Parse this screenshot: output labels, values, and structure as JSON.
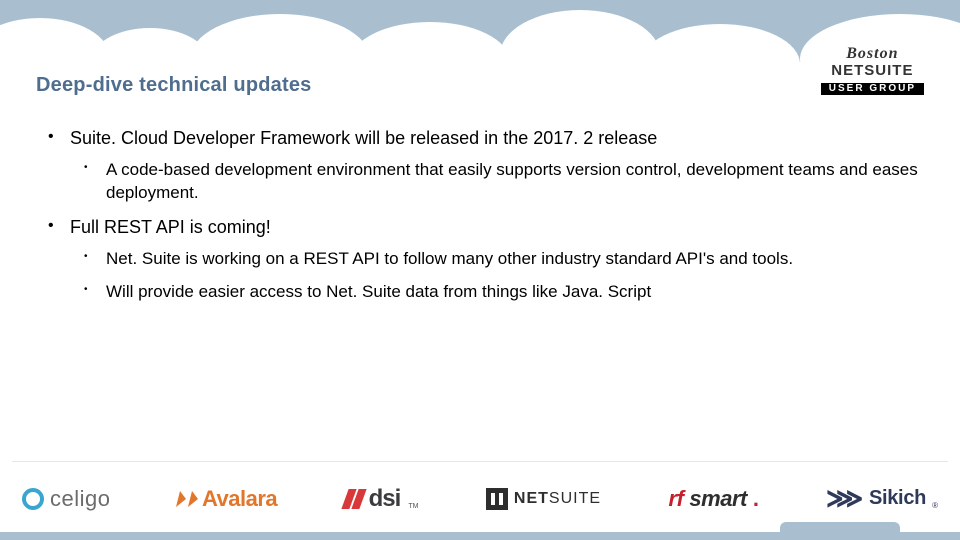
{
  "title": "Deep-dive technical updates",
  "brand": {
    "line1": "Boston",
    "line2_a": "NET",
    "line2_b": "SUITE",
    "line3": "USER GROUP"
  },
  "bullets": [
    {
      "text": "Suite. Cloud Developer Framework will be released in the 2017. 2 release",
      "children": [
        "A code-based development environment that easily supports version control, development teams and eases deployment."
      ]
    },
    {
      "text": "Full REST API is coming!",
      "children": [
        "Net. Suite is working on a REST API to follow many other industry standard API's and tools.",
        "Will provide easier access to Net. Suite data from things like Java. Script"
      ]
    }
  ],
  "logos": {
    "celigo": "celigo",
    "avalara": "Avalara",
    "dsi": "dsi",
    "netsuite_a": "NET",
    "netsuite_b": "SUITE",
    "rfsmart_a": "rf",
    "rfsmart_b": "smart",
    "sikich": "Sikich"
  }
}
